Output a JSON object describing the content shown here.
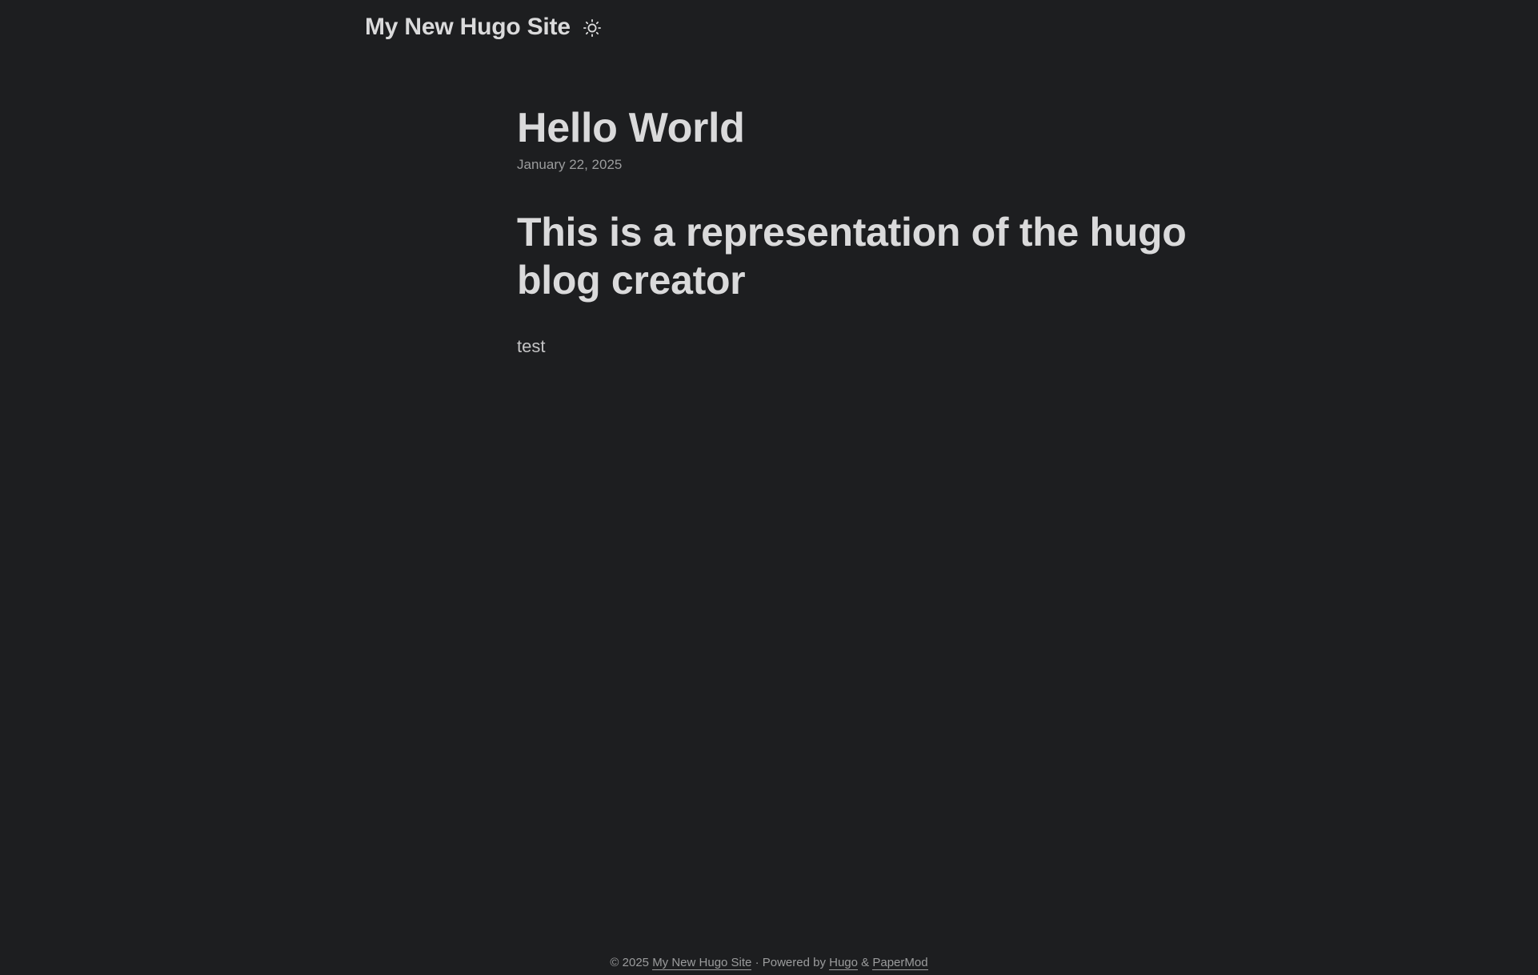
{
  "header": {
    "site_title": "My New Hugo Site",
    "theme_toggle_icon": "sun-icon"
  },
  "post": {
    "title": "Hello World",
    "date": "January 22, 2025",
    "content": {
      "heading": "This is a representation of the hugo blog creator",
      "paragraph": "test"
    }
  },
  "footer": {
    "copyright": "© 2025",
    "site_link": "My New Hugo Site",
    "separator": "· Powered by",
    "hugo_link": "Hugo",
    "ampersand": "&",
    "theme_link": "PaperMod"
  },
  "colors": {
    "background": "#1d1e20",
    "primary_text": "#dadadb",
    "secondary_text": "#9b9c9d"
  }
}
